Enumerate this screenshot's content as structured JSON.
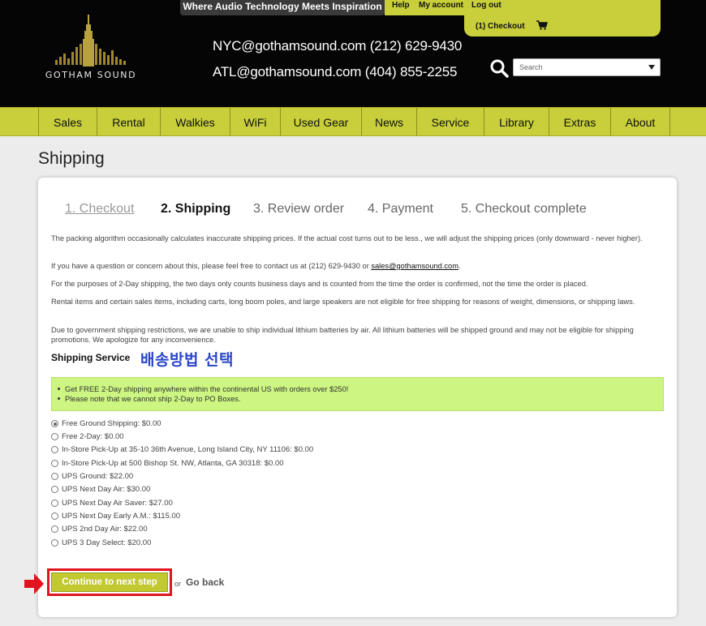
{
  "header": {
    "tagline": "Where Audio Technology Meets Inspiration",
    "links": [
      "Help",
      "My account",
      "Log out"
    ],
    "cart_text": "(1)  Checkout",
    "logo_text": "GOTHAM SOUND",
    "contact_nyc": "NYC@gothamsound.com  (212) 629-9430",
    "contact_atl": "ATL@gothamsound.com  (404) 855-2255",
    "search_placeholder": "Search"
  },
  "nav": [
    "Sales",
    "Rental",
    "Walkies",
    "WiFi",
    "Used Gear",
    "News",
    "Service",
    "Library",
    "Extras",
    "About"
  ],
  "page_title": "Shipping",
  "steps": [
    "1. Checkout",
    "2. Shipping",
    "3. Review order",
    "4. Payment",
    "5. Checkout complete"
  ],
  "paragraphs": {
    "p1": "The packing algorithm occasionally calculates inaccurate shipping prices. If the actual cost turns out to be less., we will adjust the shipping prices (only downward - never higher).",
    "p2_pre": "If you have a question or concern about this, please feel free to contact us at (212) 629-9430 or ",
    "p2_link": "sales@gothamsound.com",
    "p2_post": ".",
    "p3": "For the purposes of 2-Day shipping, the two days only counts business days and is counted from the time the order is confirmed, not the time the order is placed.",
    "p4": "Rental items and certain sales items, including carts, long boom poles, and large speakers are not eligible for free shipping for reasons of weight, dimensions, or shipping laws.",
    "p5": "Due to government shipping restrictions, we are unable to ship individual lithium batteries by air. All lithium batteries will be shipped ground and may not be eligible for shipping promotions. We apologize for any inconvenience."
  },
  "shipping": {
    "heading": "Shipping Service",
    "korean_note": "배송방법 선택",
    "notices": [
      "Get FREE 2-Day shipping anywhere within the continental US with orders over $250!",
      "Please note that we cannot ship 2-Day to PO Boxes."
    ],
    "options": [
      "Free Ground Shipping: $0.00",
      "Free 2-Day: $0.00",
      "In-Store Pick-Up at 35-10 36th Avenue, Long Island City, NY 11106: $0.00",
      "In-Store Pick-Up at 500 Bishop St. NW, Atlanta, GA 30318: $0.00",
      "UPS Ground: $22.00",
      "UPS Next Day Air: $30.00",
      "UPS Next Day Air Saver: $27.00",
      "UPS Next Day Early A.M.: $115.00",
      "UPS 2nd Day Air: $22.00",
      "UPS 3 Day Select: $20.00"
    ],
    "selected_index": 0
  },
  "actions": {
    "continue_label": "Continue to next step",
    "or_label": "or",
    "back_label": "Go back"
  },
  "colors": {
    "accent": "#c8cf3a",
    "highlight": "#e0141e",
    "notice_bg": "#ccf582",
    "korean_text": "#2a46c8"
  }
}
